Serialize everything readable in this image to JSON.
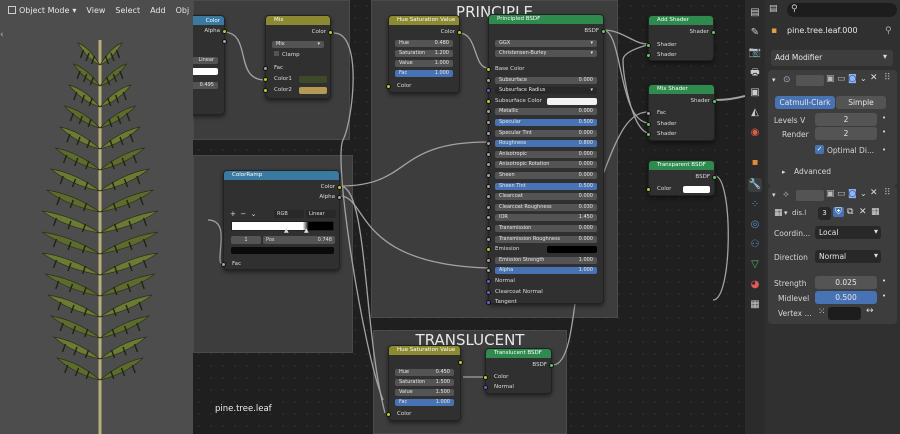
{
  "viewport": {
    "mode_label": "Object Mode",
    "menu": [
      "View",
      "Select",
      "Add",
      "Obj"
    ],
    "object_label": "pine.tree.leaf"
  },
  "frames": {
    "principle": "PRINCIPLE",
    "translucent": "TRANSLUCENT"
  },
  "nodes": {
    "tex_left": {
      "out1": "Color",
      "out2": "Alpha",
      "mode": "Linear",
      "value": "0.495"
    },
    "mix": {
      "title": "Mix",
      "out": "Color",
      "blend": "Mix",
      "clamp": "Clamp",
      "in1": "Fac",
      "in2": "Color1",
      "in3": "Color2",
      "c1": "#3d4a2a",
      "c2": "#b59a55"
    },
    "hsv1": {
      "title": "Hue Saturation Value",
      "out": "Color",
      "hue_l": "Hue",
      "hue_v": "0.480",
      "sat_l": "Saturation",
      "sat_v": "1.200",
      "val_l": "Value",
      "val_v": "1.000",
      "fac_l": "Fac",
      "fac_v": "1.000",
      "in": "Color"
    },
    "bsdf": {
      "title": "Principled BSDF",
      "out": "BSDF",
      "dist": "GGX",
      "sss": "Christensen-Burley",
      "rows": [
        {
          "label": "Base Color",
          "value": "",
          "type": "label"
        },
        {
          "label": "Subsurface",
          "value": "0.000",
          "type": "field"
        },
        {
          "label": "Subsurface Radius",
          "value": "",
          "type": "drop"
        },
        {
          "label": "Subsurface Color",
          "value": "",
          "type": "white"
        },
        {
          "label": "Metallic",
          "value": "0.000",
          "type": "field"
        },
        {
          "label": "Specular",
          "value": "0.500",
          "type": "blue"
        },
        {
          "label": "Specular Tint",
          "value": "0.000",
          "type": "field"
        },
        {
          "label": "Roughness",
          "value": "0.800",
          "type": "blue"
        },
        {
          "label": "Anisotropic",
          "value": "0.000",
          "type": "field"
        },
        {
          "label": "Anisotropic Rotation",
          "value": "0.000",
          "type": "field"
        },
        {
          "label": "Sheen",
          "value": "0.000",
          "type": "field"
        },
        {
          "label": "Sheen Tint",
          "value": "0.500",
          "type": "blue"
        },
        {
          "label": "Clearcoat",
          "value": "0.000",
          "type": "field"
        },
        {
          "label": "Clearcoat Roughness",
          "value": "0.030",
          "type": "field"
        },
        {
          "label": "IOR",
          "value": "1.450",
          "type": "field"
        },
        {
          "label": "Transmission",
          "value": "0.000",
          "type": "field"
        },
        {
          "label": "Transmission Roughness",
          "value": "0.000",
          "type": "field"
        },
        {
          "label": "Emission",
          "value": "",
          "type": "black"
        },
        {
          "label": "Emission Strength",
          "value": "1.000",
          "type": "field"
        },
        {
          "label": "Alpha",
          "value": "1.000",
          "type": "blue"
        },
        {
          "label": "Normal",
          "value": "",
          "type": "label"
        },
        {
          "label": "Clearcoat Normal",
          "value": "",
          "type": "label"
        },
        {
          "label": "Tangent",
          "value": "",
          "type": "label"
        }
      ]
    },
    "add_shader": {
      "title": "Add Shader",
      "out": "Shader",
      "in1": "Shader",
      "in2": "Shader"
    },
    "mix_shader": {
      "title": "Mix Shader",
      "out": "Shader",
      "in1": "Fac",
      "in2": "Shader",
      "in3": "Shader"
    },
    "transparent": {
      "title": "Transparent BSDF",
      "out": "BSDF",
      "in": "Color"
    },
    "colorramp": {
      "title": "ColorRamp",
      "out1": "Color",
      "out2": "Alpha",
      "interp1": "RGB",
      "interp2": "Linear",
      "index": "1",
      "pos_l": "Pos",
      "pos_v": "0.748",
      "in": "Fac"
    },
    "hsv2": {
      "title": "Hue Saturation Value",
      "hue_l": "Hue",
      "hue_v": "0.450",
      "sat_l": "Saturation",
      "sat_v": "1.500",
      "val_l": "Value",
      "val_v": "1.500",
      "fac_l": "Fac",
      "fac_v": "1.000",
      "in": "Color"
    },
    "translucent": {
      "title": "Translucent BSDF",
      "out": "BSDF",
      "in1": "Color",
      "in2": "Normal"
    }
  },
  "properties": {
    "search_placeholder": "",
    "object_name": "pine.tree.leaf.000",
    "add_modifier": "Add Modifier",
    "subsurf": {
      "tab1": "Catmull-Clark",
      "tab2": "Simple",
      "levels_l": "Levels V",
      "levels_v": "2",
      "render_l": "Render",
      "render_v": "2",
      "optimal": "Optimal Di...",
      "advanced": "Advanced"
    },
    "displace": {
      "tex_name": "dis.l",
      "users": "3",
      "coord_l": "Coordin...",
      "coord_v": "Local",
      "dir_l": "Direction",
      "dir_v": "Normal",
      "str_l": "Strength",
      "str_v": "0.025",
      "mid_l": "Midlevel",
      "mid_v": "0.500",
      "vert_l": "Vertex ..."
    }
  },
  "colors": {
    "accent": "#4772b3",
    "node_yellow": "#8c8a31",
    "node_green": "#2e8a4d",
    "node_blue": "#3a7aa0"
  }
}
